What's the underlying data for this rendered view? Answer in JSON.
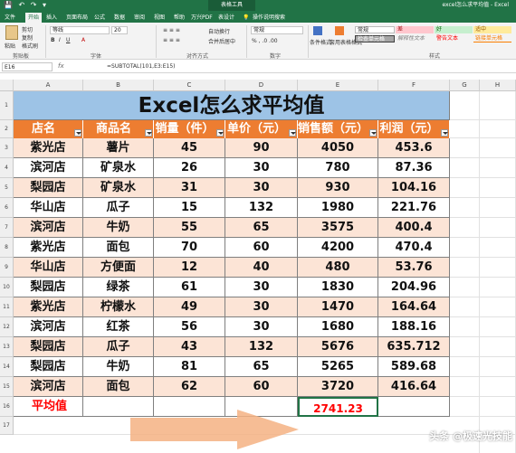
{
  "titlebar": {
    "quick_access": "💾 ↶ ↷ ▾",
    "context_tab": "表格工具",
    "window_title": "excel怎么求平均值 - Excel"
  },
  "tabs": [
    "文件",
    "开始",
    "插入",
    "页面布局",
    "公式",
    "数据",
    "审阅",
    "视图",
    "帮助",
    "万兴PDF",
    "表设计",
    "💡",
    "操作说明搜索"
  ],
  "ribbon": {
    "clipboard": {
      "paste": "粘贴",
      "cut": "剪切",
      "copy": "复制",
      "format_painter": "格式刷",
      "label": "剪贴板"
    },
    "font": {
      "name": "等线",
      "size": "20",
      "label": "字体"
    },
    "alignment": {
      "wrap": "自动换行",
      "merge": "合并后居中",
      "label": "对齐方式"
    },
    "number": {
      "format": "常规",
      "label": "数字"
    },
    "styles": {
      "conditional": "条件格式",
      "table": "套用表格格式",
      "normal": "常规",
      "bad": "差",
      "good": "好",
      "neutral": "适中",
      "check_cell": "检查单元格",
      "explanatory": "解释性文本",
      "warning": "警告文本",
      "linked": "链接单元格",
      "label": "样式"
    }
  },
  "formula_bar": {
    "cell_ref": "E16",
    "fx": "fx",
    "formula": "=SUBTOTAL(101,E3:E15)"
  },
  "columns": [
    "A",
    "B",
    "C",
    "D",
    "E",
    "F",
    "G",
    "H"
  ],
  "rows": [
    "1",
    "2",
    "3",
    "4",
    "5",
    "6",
    "7",
    "8",
    "9",
    "10",
    "11",
    "12",
    "13",
    "14",
    "15",
    "16",
    "17"
  ],
  "sheet": {
    "title": "Excel怎么求平均值",
    "headers": [
      "店名",
      "商品名",
      "销量（件）",
      "单价（元）",
      "销售额（元）",
      "利润（元）"
    ],
    "data": [
      [
        "紫光店",
        "薯片",
        "45",
        "90",
        "4050",
        "453.6"
      ],
      [
        "滨河店",
        "矿泉水",
        "26",
        "30",
        "780",
        "87.36"
      ],
      [
        "梨园店",
        "矿泉水",
        "31",
        "30",
        "930",
        "104.16"
      ],
      [
        "华山店",
        "瓜子",
        "15",
        "132",
        "1980",
        "221.76"
      ],
      [
        "滨河店",
        "牛奶",
        "55",
        "65",
        "3575",
        "400.4"
      ],
      [
        "紫光店",
        "面包",
        "70",
        "60",
        "4200",
        "470.4"
      ],
      [
        "华山店",
        "方便面",
        "12",
        "40",
        "480",
        "53.76"
      ],
      [
        "梨园店",
        "绿茶",
        "61",
        "30",
        "1830",
        "204.96"
      ],
      [
        "紫光店",
        "柠檬水",
        "49",
        "30",
        "1470",
        "164.64"
      ],
      [
        "滨河店",
        "红茶",
        "56",
        "30",
        "1680",
        "188.16"
      ],
      [
        "梨园店",
        "瓜子",
        "43",
        "132",
        "5676",
        "635.712"
      ],
      [
        "梨园店",
        "牛奶",
        "81",
        "65",
        "5265",
        "589.68"
      ],
      [
        "滨河店",
        "面包",
        "62",
        "60",
        "3720",
        "416.64"
      ]
    ],
    "avg_label": "平均值",
    "avg_value": "2741.23"
  },
  "watermark": "头条 @极速光技能",
  "colors": {
    "title_bg": "#9dc3e6",
    "header_bg": "#ed7d31",
    "band_light": "#fce4d6",
    "band_white": "#ffffff",
    "accent_red": "#ff0000",
    "arrow": "#f4b183",
    "excel_green": "#217346"
  }
}
